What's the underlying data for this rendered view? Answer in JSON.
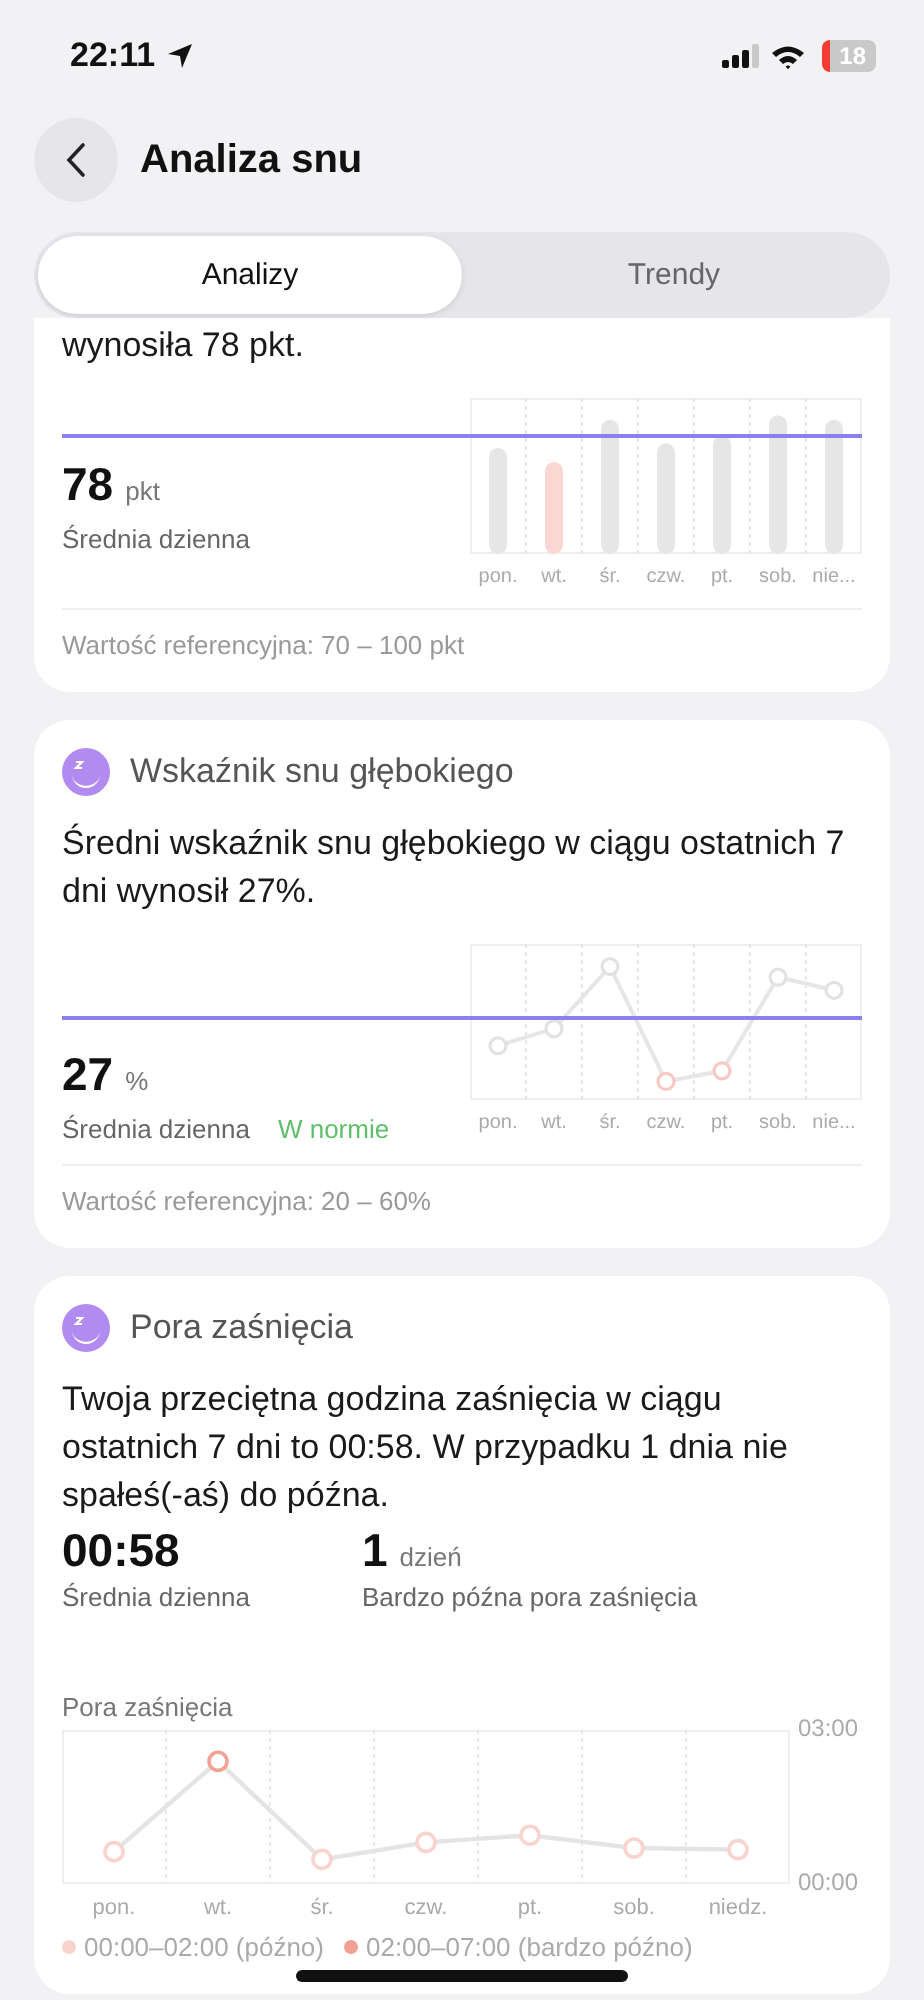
{
  "status_bar": {
    "time": "22:11",
    "battery": "18"
  },
  "header": {
    "title": "Analiza snu"
  },
  "tabs": [
    {
      "label": "Analizy",
      "selected": true
    },
    {
      "label": "Trendy",
      "selected": false
    }
  ],
  "cards": [
    {
      "kind": "bars",
      "summary": "wynosiła 78 pkt.",
      "value": "78",
      "unit": "pkt",
      "value_label": "Średnia dzienna",
      "days": [
        {
          "label": "pon.",
          "flagged": false
        },
        {
          "label": "wt.",
          "flagged": true
        },
        {
          "label": "śr.",
          "flagged": false
        },
        {
          "label": "czw.",
          "flagged": false
        },
        {
          "label": "pt.",
          "flagged": false
        },
        {
          "label": "sob.",
          "flagged": false
        },
        {
          "label": "nie...",
          "flagged": false
        }
      ],
      "reference": "Wartość referencyjna: 70 – 100 pkt"
    },
    {
      "kind": "line",
      "title": "Wskaźnik snu głębokiego",
      "summary": "Średni wskaźnik snu głębokiego w ciągu ostatnich 7 dni wynosił 27%.",
      "value": "27",
      "unit": "%",
      "value_label": "Średnia dzienna",
      "status": "W normie",
      "days": [
        {
          "label": "pon.",
          "flagged": false
        },
        {
          "label": "wt.",
          "flagged": false
        },
        {
          "label": "śr.",
          "flagged": false
        },
        {
          "label": "czw.",
          "flagged": true
        },
        {
          "label": "pt.",
          "flagged": true
        },
        {
          "label": "sob.",
          "flagged": false
        },
        {
          "label": "nie...",
          "flagged": false
        }
      ],
      "reference": "Wartość referencyjna: 20 – 60%"
    },
    {
      "kind": "bedtime",
      "title": "Pora zaśnięcia",
      "summary": "Twoja przeciętna godzina zaśnięcia w ciągu ostatnich 7 dni to 00:58. W przypadku 1 dnia nie spałeś(-aś) do późna.",
      "stats": [
        {
          "value": "00:58",
          "label": "Średnia dzienna"
        },
        {
          "value": "1",
          "unit": "dzień",
          "label": "Bardzo późna pora zaśnięcia"
        }
      ],
      "chart_data": {
        "type": "line",
        "title": "Pora zaśnięcia",
        "categories": [
          "pon.",
          "wt.",
          "śr.",
          "czw.",
          "pt.",
          "sob.",
          "niedz."
        ],
        "series": [
          {
            "color": "#e4e4e4",
            "marker": "circle",
            "values": [
              0.63,
              2.39,
              0.48,
              0.81,
              0.95,
              0.7,
              0.67
            ]
          }
        ],
        "ylim": [
          0,
          3
        ],
        "yticks": [
          {
            "value": 0,
            "label": "00:00"
          },
          {
            "value": 3,
            "label": "03:00"
          }
        ]
      },
      "legend": [
        {
          "label": "00:00–02:00 (późno)",
          "color": "#f9d4cf"
        },
        {
          "label": "02:00–07:00 (bardzo późno)",
          "color": "#f2a195"
        }
      ]
    }
  ]
}
